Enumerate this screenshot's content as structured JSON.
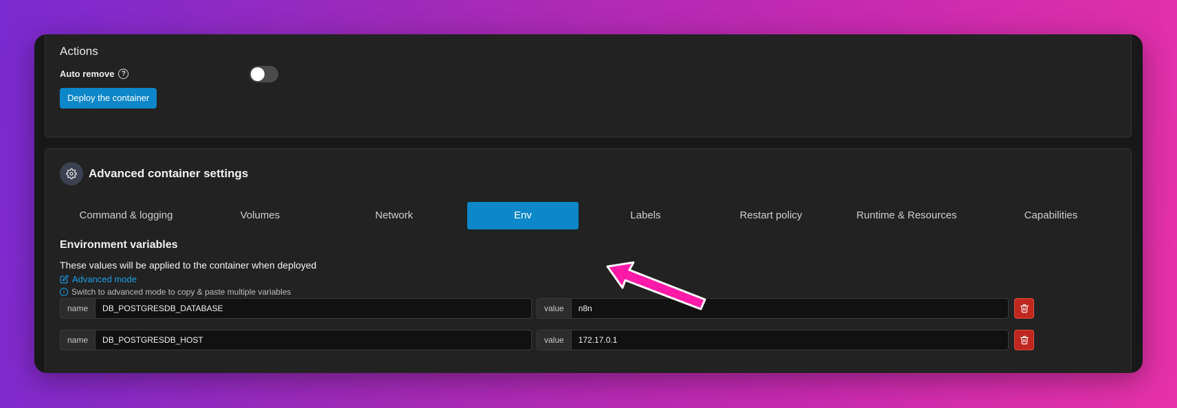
{
  "actions": {
    "title": "Actions",
    "auto_remove_label": "Auto remove",
    "auto_remove_on": false,
    "deploy_label": "Deploy the container"
  },
  "advanced": {
    "title": "Advanced container settings",
    "tabs": [
      {
        "label": "Command & logging",
        "active": false
      },
      {
        "label": "Volumes",
        "active": false
      },
      {
        "label": "Network",
        "active": false
      },
      {
        "label": "Env",
        "active": true
      },
      {
        "label": "Labels",
        "active": false
      },
      {
        "label": "Restart policy",
        "active": false
      },
      {
        "label": "Runtime & Resources",
        "active": false
      },
      {
        "label": "Capabilities",
        "active": false
      }
    ]
  },
  "env": {
    "title": "Environment variables",
    "description": "These values will be applied to the container when deployed",
    "advanced_mode_label": "Advanced mode",
    "hint": "Switch to advanced mode to copy & paste multiple variables",
    "name_addon": "name",
    "value_addon": "value",
    "rows": [
      {
        "name": "DB_POSTGRESDB_DATABASE",
        "value": "n8n"
      },
      {
        "name": "DB_POSTGRESDB_HOST",
        "value": "172.17.0.1"
      }
    ]
  },
  "colors": {
    "accent": "#0d87c9",
    "danger": "#c0281f",
    "arrow": "#ff1aa8"
  },
  "icons": {
    "help": "question-circle-icon",
    "gear": "gear-icon",
    "edit": "edit-icon",
    "info": "info-icon",
    "trash": "trash-icon",
    "arrow": "pointer-arrow"
  }
}
